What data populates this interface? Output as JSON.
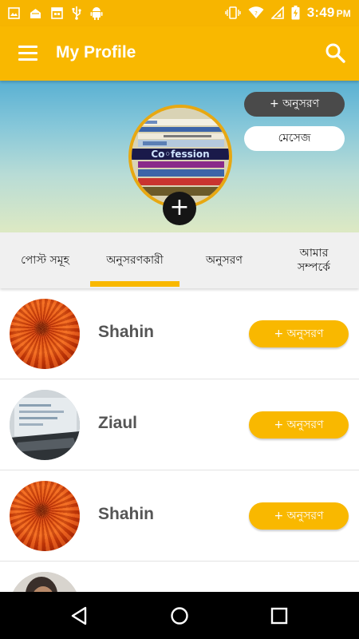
{
  "status_bar": {
    "time": "3:49",
    "ampm": "PM",
    "icons_left": [
      "gallery-icon",
      "mail-icon",
      "calendar-icon",
      "usb-icon",
      "android-icon"
    ],
    "icons_right": [
      "vibrate-icon",
      "wifi-icon",
      "signal-icon",
      "battery-charging-icon"
    ]
  },
  "app_bar": {
    "title": "My Profile",
    "menu_icon": "hamburger-menu-icon",
    "search_icon": "search-icon"
  },
  "profile": {
    "follow_label": "+ অনুসরণ",
    "message_label": "মেসেজ",
    "add_photo_label": "+"
  },
  "tabs": [
    {
      "label": "পোস্ট সমূহ",
      "active": false
    },
    {
      "label": "অনুসরণকারী",
      "active": true
    },
    {
      "label": "অনুসরণ",
      "active": false
    },
    {
      "label": "আমার সম্পর্কে",
      "active": false
    }
  ],
  "followers": [
    {
      "name": "Shahin",
      "follow_label": "+ অনুসরণ",
      "avatar": "flower"
    },
    {
      "name": "Ziaul",
      "follow_label": "+ অনুসরণ",
      "avatar": "screen-photo"
    },
    {
      "name": "Shahin",
      "follow_label": "+ অনুসরণ",
      "avatar": "flower"
    },
    {
      "name": "",
      "follow_label": "",
      "avatar": "person"
    }
  ],
  "colors": {
    "primary": "#f9b800",
    "dark_button": "#4a4a4a",
    "name_text": "#555555"
  },
  "nav_bar": {
    "icons": [
      "back-icon",
      "home-icon",
      "recents-icon"
    ]
  }
}
